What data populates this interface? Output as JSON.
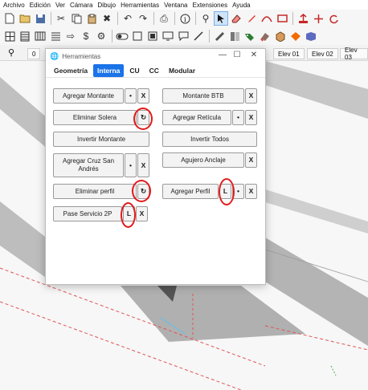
{
  "menu": [
    "Archivo",
    "Edición",
    "Ver",
    "Cámara",
    "Dibujo",
    "Herramientas",
    "Ventana",
    "Extensiones",
    "Ayuda"
  ],
  "toolbar_row1": [
    "new-file-icon",
    "open-folder-icon",
    "save-icon",
    "sep",
    "cut-icon",
    "copy-icon",
    "paste-icon",
    "erase-icon",
    "sep",
    "undo-icon",
    "redo-icon",
    "sep",
    "print-icon",
    "sep",
    "info-icon",
    "sep",
    "search-icon",
    "select-arrow-icon",
    "eraser-icon",
    "pencil-icon",
    "arc-icon",
    "rectangle-icon",
    "sep",
    "pushpull-icon",
    "move-icon",
    "rotate-icon"
  ],
  "toolbar_row2": [
    "copy-grid-icon",
    "panel-icon",
    "wall-icon",
    "stack-icon",
    "arrow-icon",
    "dollar-icon",
    "gear-icon",
    "sep",
    "toggle-icon",
    "square-outline-icon",
    "fill-square-icon",
    "display-icon",
    "comment-icon",
    "diag-line-icon",
    "sep",
    "ruler-icon",
    "level-icon",
    "tag-icon",
    "paint-icon",
    "box-icon",
    "section-icon",
    "camera-icon"
  ],
  "scenes": {
    "tabs": [
      "0",
      "Elev 01",
      "Elev 02",
      "Elev 03"
    ]
  },
  "dialog": {
    "title": "Herramientas",
    "min": "—",
    "max": "☐",
    "close": "✕",
    "tabs": [
      {
        "label": "Geometría",
        "active": false
      },
      {
        "label": "Interna",
        "active": true
      },
      {
        "label": "CU",
        "active": false
      },
      {
        "label": "CC",
        "active": false
      },
      {
        "label": "Modular",
        "active": false
      }
    ],
    "buttons": {
      "agregar_montante": "Agregar Montante",
      "agregar_montante_dot": "•",
      "agregar_montante_x": "X",
      "montante_btb": "Montante BTB",
      "montante_btb_x": "X",
      "eliminar_solera": "Eliminar Solera",
      "eliminar_solera_refresh": "↻",
      "agregar_reticula": "Agregar Retícula",
      "agregar_reticula_dot": "•",
      "agregar_reticula_x": "X",
      "invertir_montante": "Invertir Montante",
      "invertir_todos": "Invertir Todos",
      "agregar_cruz_line1": "Agregar Cruz San",
      "agregar_cruz_line2": "Andrés",
      "agregar_cruz_dot": "•",
      "agregar_cruz_x": "X",
      "agujero_anclaje": "Agujero Anclaje",
      "agujero_anclaje_x": "X",
      "eliminar_perfil": "Eliminar perfil",
      "eliminar_perfil_refresh": "↻",
      "agregar_perfil": "Agregar Perfil",
      "agregar_perfil_l": "L",
      "agregar_perfil_dot": "•",
      "agregar_perfil_x": "X",
      "pase_servicio": "Pase Servicio 2P",
      "pase_servicio_l": "L",
      "pase_servicio_x": "X"
    }
  },
  "colors": {
    "tab_active": "#1a73e8",
    "annotation": "#e21a1a",
    "beam": "#b4b4b4",
    "dashed_line": "#e05555"
  }
}
